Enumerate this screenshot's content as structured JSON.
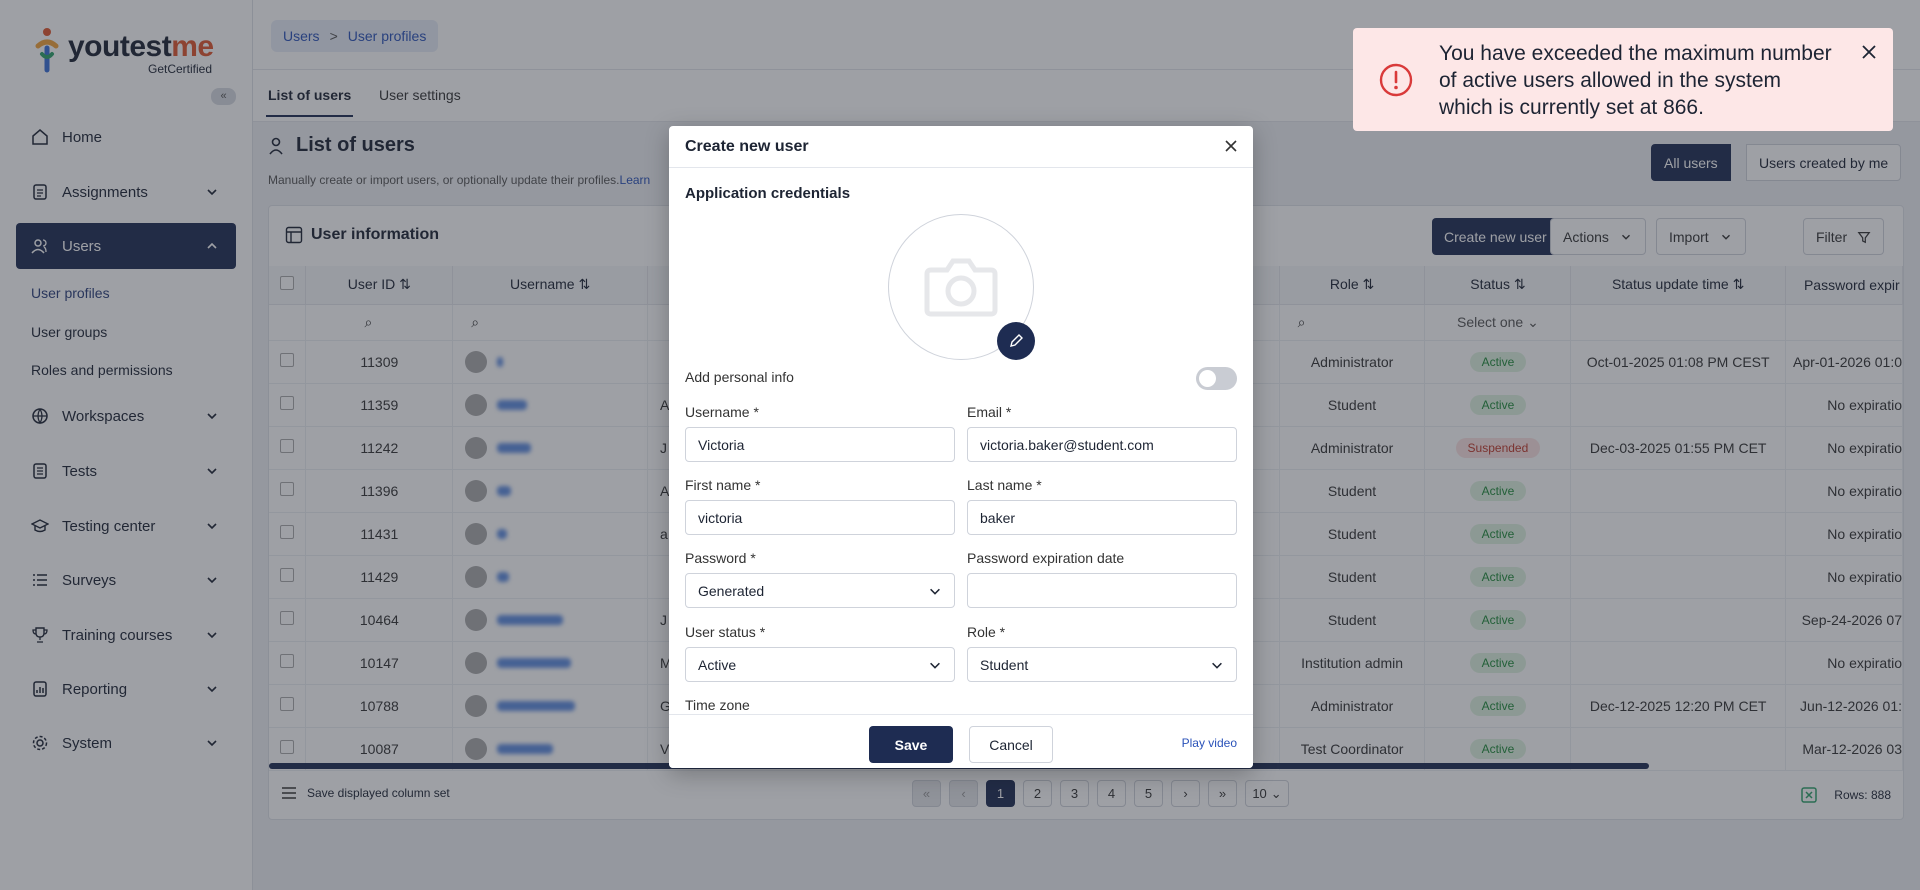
{
  "brand": {
    "name_prefix": "youtest",
    "name_accent": "me",
    "sub": "GetCertified"
  },
  "sidebar": {
    "items": [
      {
        "label": "Home"
      },
      {
        "label": "Assignments"
      },
      {
        "label": "Users"
      },
      {
        "label": "Workspaces"
      },
      {
        "label": "Tests"
      },
      {
        "label": "Testing center"
      },
      {
        "label": "Surveys"
      },
      {
        "label": "Training courses"
      },
      {
        "label": "Reporting"
      },
      {
        "label": "System"
      }
    ],
    "users_sub": [
      "User profiles",
      "User groups",
      "Roles and permissions"
    ]
  },
  "breadcrumb": [
    "Users",
    ">",
    "User profiles"
  ],
  "tabs": [
    "List of users",
    "User settings"
  ],
  "page": {
    "title": "List of users",
    "description": "Manually create or import users, or optionally update their profiles.",
    "learn": "Learn",
    "toggle_all": "All users",
    "toggle_mine": "Users created by me"
  },
  "card": {
    "title": "User information",
    "create_btn": "Create new user",
    "actions_btn": "Actions",
    "import_btn": "Import",
    "filter_btn": "Filter"
  },
  "table": {
    "columns": [
      "User ID",
      "Username",
      "Role",
      "Status",
      "Status update time",
      "Password expir"
    ],
    "status_filter": "Select one",
    "rows": [
      {
        "id": "11309",
        "initial": "",
        "role": "Administrator",
        "status": "Active",
        "updated": "Oct-01-2025 01:08 PM CEST",
        "exp": "Apr-01-2026 01:0"
      },
      {
        "id": "11359",
        "initial": "A",
        "role": "Student",
        "status": "Active",
        "updated": "",
        "exp": "No expiratio"
      },
      {
        "id": "11242",
        "initial": "J",
        "role": "Administrator",
        "status": "Suspended",
        "updated": "Dec-03-2025 01:55 PM CET",
        "exp": "No expiratio"
      },
      {
        "id": "11396",
        "initial": "A",
        "role": "Student",
        "status": "Active",
        "updated": "",
        "exp": "No expiratio"
      },
      {
        "id": "11431",
        "initial": "a",
        "role": "Student",
        "status": "Active",
        "updated": "",
        "exp": "No expiratio"
      },
      {
        "id": "11429",
        "initial": "",
        "role": "Student",
        "status": "Active",
        "updated": "",
        "exp": "No expiratio"
      },
      {
        "id": "10464",
        "initial": "J",
        "role": "Student",
        "status": "Active",
        "updated": "",
        "exp": "Sep-24-2026 07"
      },
      {
        "id": "10147",
        "initial": "M",
        "role": "Institution admin",
        "status": "Active",
        "updated": "",
        "exp": "No expiratio"
      },
      {
        "id": "10788",
        "initial": "G",
        "role": "Administrator",
        "status": "Active",
        "updated": "Dec-12-2025 12:20 PM CET",
        "exp": "Jun-12-2026 01:"
      },
      {
        "id": "10087",
        "initial": "V",
        "role": "Test Coordinator",
        "status": "Active",
        "updated": "",
        "exp": "Mar-12-2026 03"
      }
    ]
  },
  "footer": {
    "save_columns": "Save displayed column set",
    "pages": [
      "1",
      "2",
      "3",
      "4",
      "5"
    ],
    "page_size": "10",
    "rows": "Rows: 888"
  },
  "modal": {
    "title": "Create new user",
    "section": "Application credentials",
    "add_personal": "Add personal info",
    "username_label": "Username",
    "username_value": "Victoria",
    "email_label": "Email",
    "email_value": "victoria.baker@student.com",
    "first_label": "First name",
    "first_value": "victoria",
    "last_label": "Last name",
    "last_value": "baker",
    "password_label": "Password",
    "password_value": "Generated",
    "pexp_label": "Password expiration date",
    "status_label": "User status",
    "status_value": "Active",
    "role_label": "Role",
    "role_value": "Student",
    "tz_label": "Time zone",
    "save": "Save",
    "cancel": "Cancel",
    "play": "Play video"
  },
  "toast": {
    "message": "You have exceeded the maximum number of active users allowed in the system which is currently set at 866."
  },
  "colors": {
    "primary": "#1e2c52",
    "accent": "#e0572f",
    "danger": "#d93a3a",
    "success": "#1f8a3a"
  }
}
